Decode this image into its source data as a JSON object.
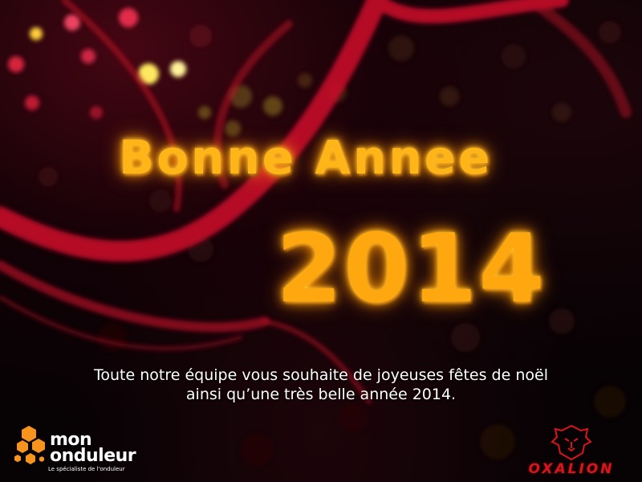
{
  "greeting": {
    "title": "Bonne Annee",
    "year": "2014",
    "message_line1": "Toute notre équipe vous souhaite de joyeuses fêtes de noël",
    "message_line2": "ainsi qu’une très belle année 2014."
  },
  "logos": {
    "mon_onduleur": {
      "name_line1": "mon",
      "name_line2": "onduleur",
      "tagline": "Le spécialiste de l'onduleur",
      "icon": "hexagon-cluster-icon",
      "color": "#f7941d"
    },
    "oxalion": {
      "name": "OXALION",
      "icon": "lion-head-icon",
      "color": "#d8151e"
    }
  },
  "colors": {
    "title": "#ffb417",
    "message": "#ffffff",
    "background": "#070204",
    "swirl": "#c8102a"
  }
}
